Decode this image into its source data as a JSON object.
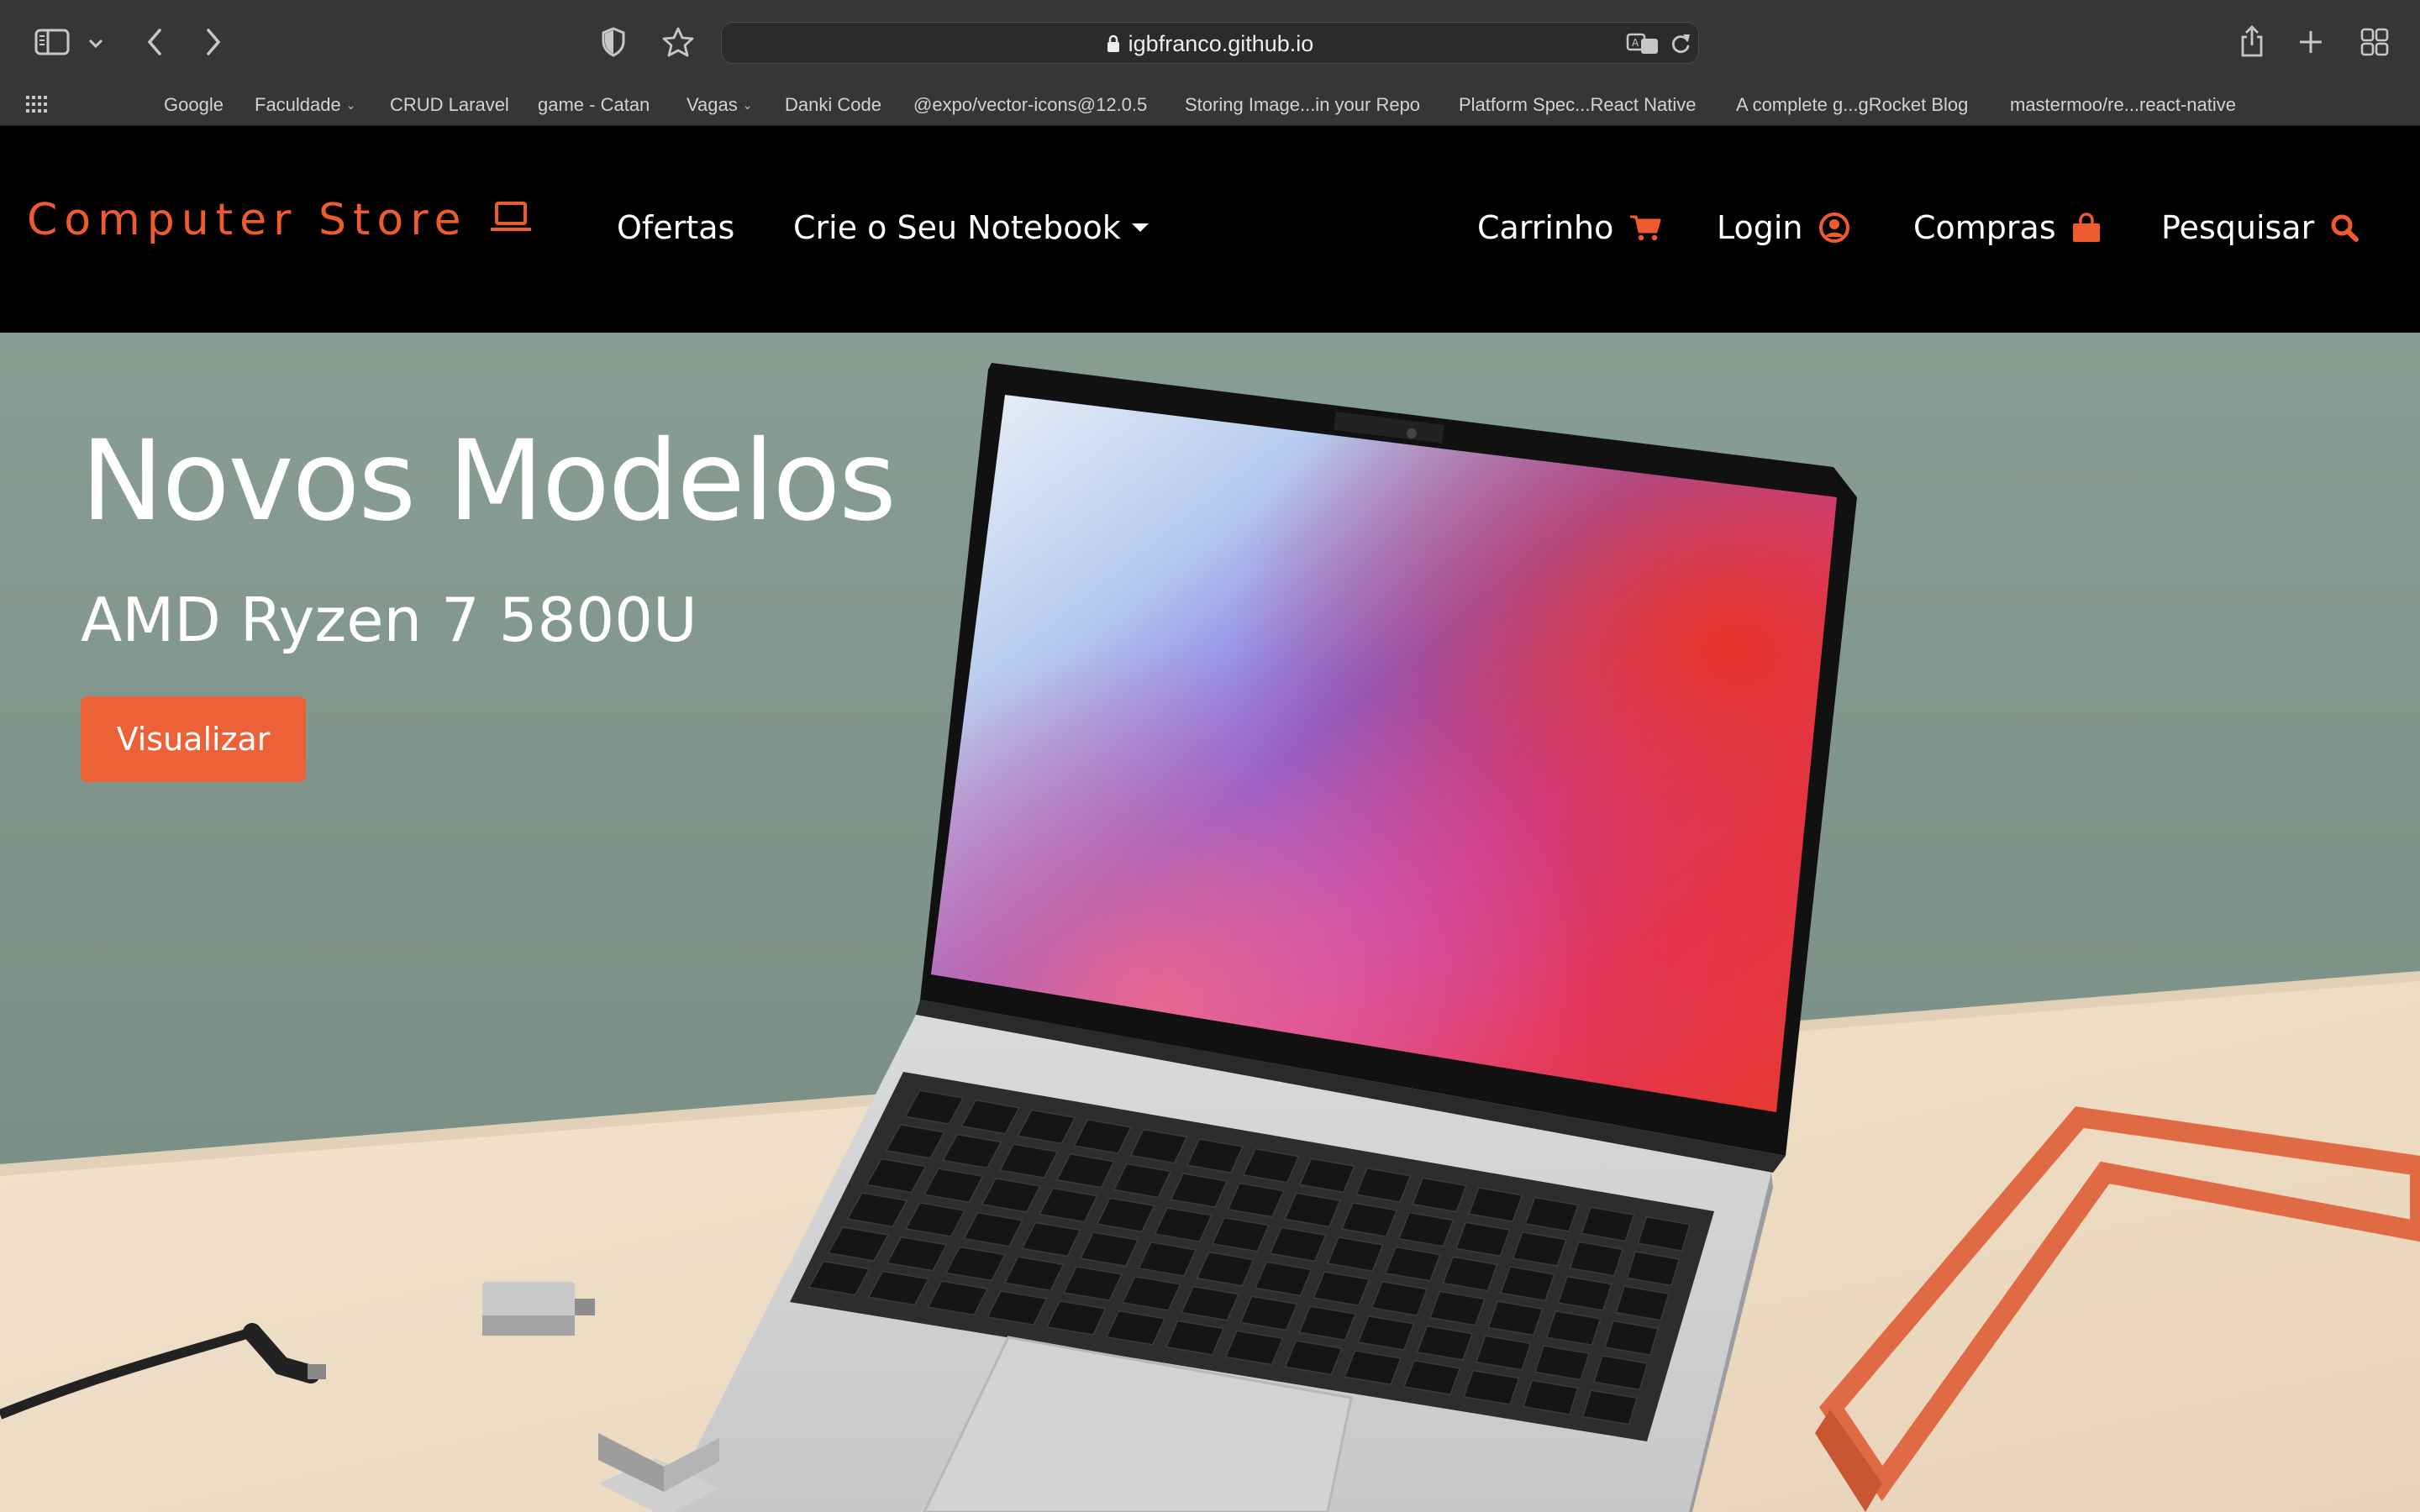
{
  "browser": {
    "url": "igbfranco.github.io",
    "bookmarks": [
      {
        "label": "Google"
      },
      {
        "label": "Faculdade",
        "chevron": true
      },
      {
        "label": "CRUD Laravel"
      },
      {
        "label": "game - Catan"
      },
      {
        "label": "Vagas",
        "chevron": true
      },
      {
        "label": "Danki Code"
      },
      {
        "label": "@expo/vector-icons@12.0.5"
      },
      {
        "label": "Storing Image...in your Repo"
      },
      {
        "label": "Platform Spec...React Native"
      },
      {
        "label": "A complete g...gRocket Blog"
      },
      {
        "label": "mastermoo/re...react-native"
      }
    ]
  },
  "site": {
    "brand": "Computer Store",
    "brand_color": "#ee5b2e",
    "nav": {
      "offers": "Ofertas",
      "build": "Crie o Seu Notebook",
      "cart": "Carrinho",
      "login": "Login",
      "purchases": "Compras",
      "search": "Pesquisar"
    },
    "icons": {
      "brand": "laptop-icon",
      "build": "caret-down-icon",
      "cart": "cart-icon",
      "login": "user-circle-icon",
      "purchases": "shopping-bag-icon",
      "search": "search-icon"
    }
  },
  "hero": {
    "title": "Novos Modelos",
    "subtitle": "AMD Ryzen 7 5800U",
    "button": "Visualizar",
    "accent": "#ec6137"
  }
}
